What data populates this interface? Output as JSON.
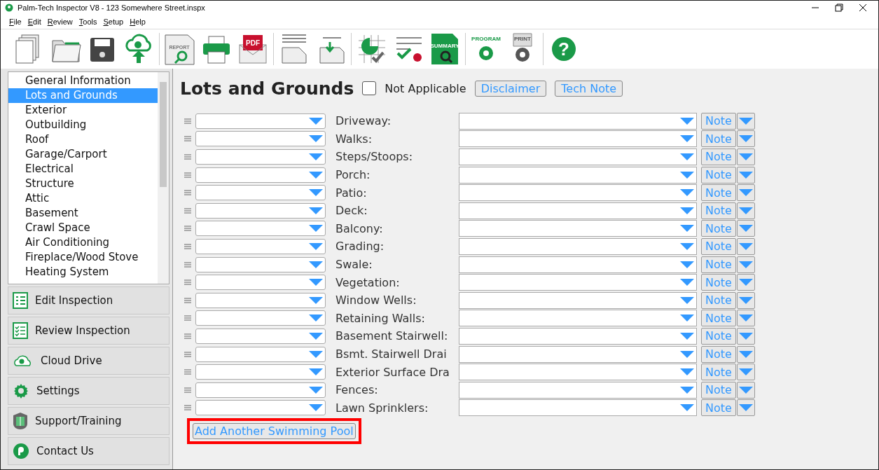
{
  "window": {
    "title": "Palm-Tech Inspector V8 - 123 Somewhere Street.inspx"
  },
  "menu": [
    {
      "label": "File"
    },
    {
      "label": "Edit"
    },
    {
      "label": "Review"
    },
    {
      "label": "Tools"
    },
    {
      "label": "Setup"
    },
    {
      "label": "Help"
    }
  ],
  "toolbar": [
    {
      "kind": "pages"
    },
    {
      "kind": "folder"
    },
    {
      "kind": "disk"
    },
    {
      "kind": "upload",
      "sep": true
    },
    {
      "kind": "report",
      "label": "REPORT"
    },
    {
      "kind": "printer"
    },
    {
      "kind": "pdf",
      "label": "PDF",
      "sep": true
    },
    {
      "kind": "page"
    },
    {
      "kind": "import",
      "sep": true
    },
    {
      "kind": "chart"
    },
    {
      "kind": "checklist"
    },
    {
      "kind": "summary",
      "label": "SUMMARY",
      "sep": true
    },
    {
      "kind": "program",
      "label": "PROGRAM"
    },
    {
      "kind": "print",
      "label": "PRINT",
      "sep": true
    },
    {
      "kind": "help",
      "label": "?"
    }
  ],
  "sections": [
    {
      "label": "General Information",
      "selected": false
    },
    {
      "label": "Lots and Grounds",
      "selected": true
    },
    {
      "label": "Exterior",
      "selected": false
    },
    {
      "label": "Outbuilding",
      "selected": false
    },
    {
      "label": "Roof",
      "selected": false
    },
    {
      "label": "Garage/Carport",
      "selected": false
    },
    {
      "label": "Electrical",
      "selected": false
    },
    {
      "label": "Structure",
      "selected": false
    },
    {
      "label": "Attic",
      "selected": false
    },
    {
      "label": "Basement",
      "selected": false
    },
    {
      "label": "Crawl Space",
      "selected": false
    },
    {
      "label": "Air Conditioning",
      "selected": false
    },
    {
      "label": "Fireplace/Wood Stove",
      "selected": false
    },
    {
      "label": "Heating System",
      "selected": false
    }
  ],
  "nav": [
    {
      "label": "Edit Inspection",
      "kind": "edit"
    },
    {
      "label": "Review Inspection",
      "kind": "review"
    },
    {
      "label": "Cloud Drive",
      "kind": "cloud"
    },
    {
      "label": "Settings",
      "kind": "settings"
    },
    {
      "label": "Support/Training",
      "kind": "support"
    },
    {
      "label": "Contact Us",
      "kind": "contact"
    }
  ],
  "page": {
    "title": "Lots and Grounds",
    "not_applicable": {
      "label": "Not Applicable",
      "checked": false
    },
    "buttons": [
      "Disclaimer",
      "Tech Note"
    ]
  },
  "rows": [
    {
      "label": "Driveway:",
      "note": "Note"
    },
    {
      "label": "Walks:",
      "note": "Note"
    },
    {
      "label": "Steps/Stoops:",
      "note": "Note"
    },
    {
      "label": "Porch:",
      "note": "Note"
    },
    {
      "label": "Patio:",
      "note": "Note"
    },
    {
      "label": "Deck:",
      "note": "Note"
    },
    {
      "label": "Balcony:",
      "note": "Note"
    },
    {
      "label": "Grading:",
      "note": "Note"
    },
    {
      "label": "Swale:",
      "note": "Note"
    },
    {
      "label": "Vegetation:",
      "note": "Note"
    },
    {
      "label": "Window Wells:",
      "note": "Note"
    },
    {
      "label": "Retaining Walls:",
      "note": "Note"
    },
    {
      "label": "Basement Stairwell:",
      "note": "Note"
    },
    {
      "label": "Bsmt. Stairwell Drai",
      "note": "Note"
    },
    {
      "label": "Exterior Surface Dra",
      "note": "Note"
    },
    {
      "label": "Fences:",
      "note": "Note"
    },
    {
      "label": "Lawn Sprinklers:",
      "note": "Note"
    }
  ],
  "add_button": {
    "label": "Add Another Swimming Pool",
    "highlighted": true
  }
}
